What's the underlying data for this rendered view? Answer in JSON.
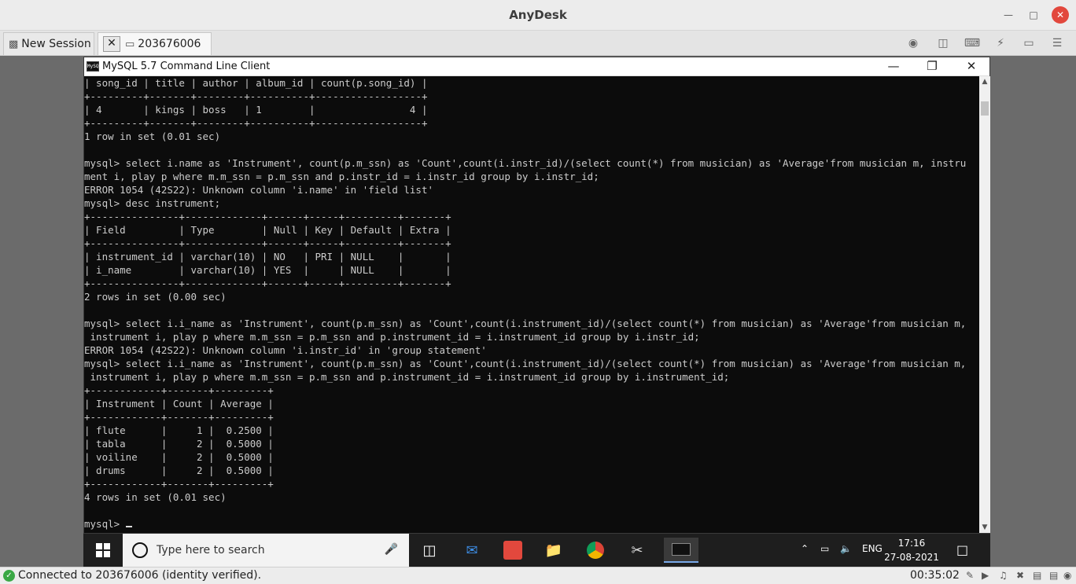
{
  "anydesk": {
    "title": "AnyDesk",
    "tabs": [
      {
        "label": "New Session"
      },
      {
        "label": "203676006"
      }
    ],
    "status_text": "Connected to 203676006 (identity verified).",
    "session_time": "00:35:02"
  },
  "mysql_window": {
    "title": "MySQL 5.7 Command Line Client",
    "icon_text": "MySQL",
    "lines": [
      "| song_id | title | author | album_id | count(p.song_id) |",
      "+---------+-------+--------+----------+------------------+",
      "| 4       | kings | boss   | 1        |                4 |",
      "+---------+-------+--------+----------+------------------+",
      "1 row in set (0.01 sec)",
      "",
      "mysql> select i.name as 'Instrument', count(p.m_ssn) as 'Count',count(i.instr_id)/(select count(*) from musician) as 'Average'from musician m, instru",
      "ment i, play p where m.m_ssn = p.m_ssn and p.instr_id = i.instr_id group by i.instr_id;",
      "ERROR 1054 (42S22): Unknown column 'i.name' in 'field list'",
      "mysql> desc instrument;",
      "+---------------+-------------+------+-----+---------+-------+",
      "| Field         | Type        | Null | Key | Default | Extra |",
      "+---------------+-------------+------+-----+---------+-------+",
      "| instrument_id | varchar(10) | NO   | PRI | NULL    |       |",
      "| i_name        | varchar(10) | YES  |     | NULL    |       |",
      "+---------------+-------------+------+-----+---------+-------+",
      "2 rows in set (0.00 sec)",
      "",
      "mysql> select i.i_name as 'Instrument', count(p.m_ssn) as 'Count',count(i.instrument_id)/(select count(*) from musician) as 'Average'from musician m,",
      " instrument i, play p where m.m_ssn = p.m_ssn and p.instrument_id = i.instrument_id group by i.instr_id;",
      "ERROR 1054 (42S22): Unknown column 'i.instr_id' in 'group statement'",
      "mysql> select i.i_name as 'Instrument', count(p.m_ssn) as 'Count',count(i.instrument_id)/(select count(*) from musician) as 'Average'from musician m,",
      " instrument i, play p where m.m_ssn = p.m_ssn and p.instrument_id = i.instrument_id group by i.instrument_id;",
      "+------------+-------+---------+",
      "| Instrument | Count | Average |",
      "+------------+-------+---------+",
      "| flute      |     1 |  0.2500 |",
      "| tabla      |     2 |  0.5000 |",
      "| voiline    |     2 |  0.5000 |",
      "| drums      |     2 |  0.5000 |",
      "+------------+-------+---------+",
      "4 rows in set (0.01 sec)",
      ""
    ],
    "prompt": "mysql> "
  },
  "taskbar": {
    "search_placeholder": "Type here to search",
    "language": "ENG",
    "time": "17:16",
    "date": "27-08-2021"
  },
  "colors": {
    "console_bg": "#0c0c0c",
    "console_text": "#cccccc",
    "close_red": "#e2483d",
    "status_green": "#3aa845"
  }
}
